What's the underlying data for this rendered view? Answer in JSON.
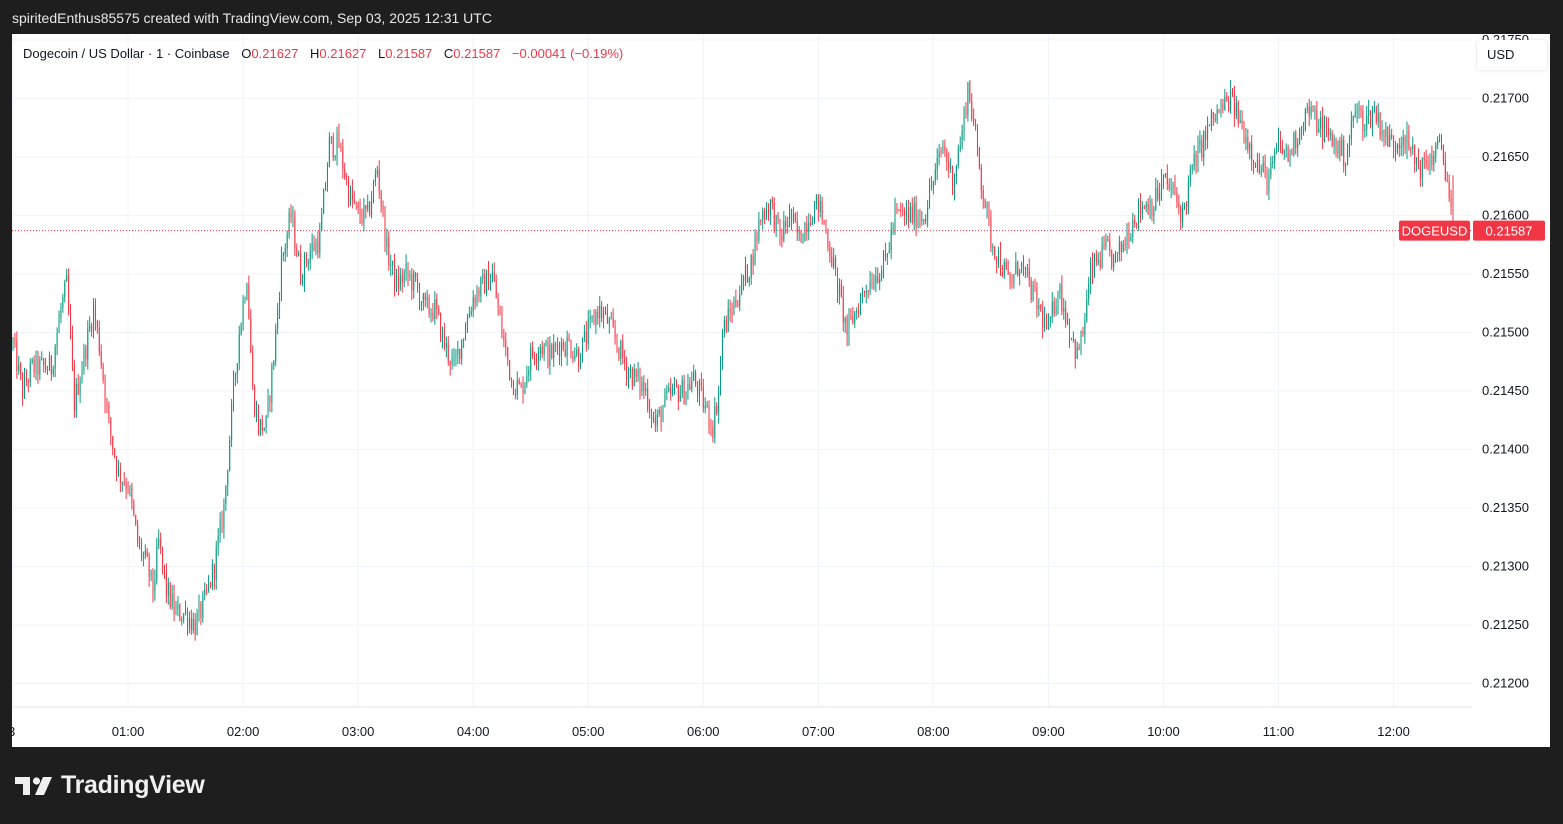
{
  "header": {
    "credit": "spiritedEnthus85575 created with TradingView.com, Sep 03, 2025 12:31 UTC"
  },
  "legend": {
    "symbol": "Dogecoin / US Dollar · 1 · Coinbase",
    "open_label": "O",
    "open": "0.21627",
    "high_label": "H",
    "high": "0.21627",
    "low_label": "L",
    "low": "0.21587",
    "close_label": "C",
    "close": "0.21587",
    "change": "−0.00041 (−0.19%)"
  },
  "currency_button": "USD",
  "price_tag": {
    "symbol": "DOGEUSD",
    "price": "0.21587"
  },
  "logo": {
    "text": "TradingView",
    "icon": "tradingview-logo-icon"
  },
  "colors": {
    "up": "#089981",
    "down": "#f23645",
    "grid": "#f0f3fa",
    "background": "#ffffff"
  },
  "chart_data": {
    "type": "candlestick",
    "title": "Dogecoin / US Dollar · 1 · Coinbase",
    "interval_minutes": 1,
    "x_ticks": [
      "3",
      "01:00",
      "02:00",
      "03:00",
      "04:00",
      "05:00",
      "06:00",
      "07:00",
      "08:00",
      "09:00",
      "10:00",
      "11:00",
      "12:00"
    ],
    "y_ticks": [
      "0.21200",
      "0.21250",
      "0.21300",
      "0.21350",
      "0.21400",
      "0.21450",
      "0.21500",
      "0.21550",
      "0.21600",
      "0.21650",
      "0.21700",
      "0.21750"
    ],
    "ylim": [
      0.2118,
      0.21755
    ],
    "x_range": [
      "00:00",
      "12:31"
    ],
    "last_price": 0.21587,
    "grid": true,
    "close_path": [
      [
        "00:00",
        0.2149
      ],
      [
        "00:05",
        0.2145
      ],
      [
        "00:10",
        0.2147
      ],
      [
        "00:15",
        0.2147
      ],
      [
        "00:20",
        0.2147
      ],
      [
        "00:25",
        0.2152
      ],
      [
        "00:28",
        0.2154
      ],
      [
        "00:32",
        0.2144
      ],
      [
        "00:37",
        0.2148
      ],
      [
        "00:42",
        0.2152
      ],
      [
        "00:45",
        0.2149
      ],
      [
        "00:50",
        0.2142
      ],
      [
        "00:55",
        0.2138
      ],
      [
        "01:00",
        0.2137
      ],
      [
        "01:05",
        0.2132
      ],
      [
        "01:10",
        0.213
      ],
      [
        "01:13",
        0.2128
      ],
      [
        "01:16",
        0.2132
      ],
      [
        "01:20",
        0.2128
      ],
      [
        "01:25",
        0.2126
      ],
      [
        "01:30",
        0.2126
      ],
      [
        "01:35",
        0.2125
      ],
      [
        "01:40",
        0.2127
      ],
      [
        "01:45",
        0.213
      ],
      [
        "01:50",
        0.2135
      ],
      [
        "01:55",
        0.2145
      ],
      [
        "01:58",
        0.215
      ],
      [
        "02:02",
        0.2155
      ],
      [
        "02:05",
        0.2145
      ],
      [
        "02:08",
        0.2142
      ],
      [
        "02:12",
        0.2142
      ],
      [
        "02:16",
        0.2148
      ],
      [
        "02:20",
        0.2156
      ],
      [
        "02:25",
        0.216
      ],
      [
        "02:30",
        0.2155
      ],
      [
        "02:35",
        0.2157
      ],
      [
        "02:40",
        0.2158
      ],
      [
        "02:45",
        0.2166
      ],
      [
        "02:50",
        0.2166
      ],
      [
        "02:55",
        0.2162
      ],
      [
        "03:00",
        0.216
      ],
      [
        "03:05",
        0.216
      ],
      [
        "03:10",
        0.2164
      ],
      [
        "03:15",
        0.2157
      ],
      [
        "03:20",
        0.2154
      ],
      [
        "03:25",
        0.2155
      ],
      [
        "03:30",
        0.2154
      ],
      [
        "03:35",
        0.2152
      ],
      [
        "03:40",
        0.2152
      ],
      [
        "03:45",
        0.2149
      ],
      [
        "03:50",
        0.2147
      ],
      [
        "03:55",
        0.215
      ],
      [
        "04:00",
        0.2153
      ],
      [
        "04:05",
        0.2154
      ],
      [
        "04:10",
        0.2155
      ],
      [
        "04:15",
        0.215
      ],
      [
        "04:20",
        0.2146
      ],
      [
        "04:25",
        0.2145
      ],
      [
        "04:30",
        0.2148
      ],
      [
        "04:35",
        0.2149
      ],
      [
        "04:40",
        0.2148
      ],
      [
        "04:45",
        0.2149
      ],
      [
        "04:50",
        0.2149
      ],
      [
        "04:55",
        0.2148
      ],
      [
        "05:00",
        0.215
      ],
      [
        "05:05",
        0.2152
      ],
      [
        "05:10",
        0.2151
      ],
      [
        "05:15",
        0.2149
      ],
      [
        "05:20",
        0.2147
      ],
      [
        "05:25",
        0.2146
      ],
      [
        "05:30",
        0.2145
      ],
      [
        "05:35",
        0.2142
      ],
      [
        "05:40",
        0.2144
      ],
      [
        "05:45",
        0.2145
      ],
      [
        "05:50",
        0.2145
      ],
      [
        "05:55",
        0.2146
      ],
      [
        "06:00",
        0.2144
      ],
      [
        "06:05",
        0.2142
      ],
      [
        "06:08",
        0.2145
      ],
      [
        "06:10",
        0.215
      ],
      [
        "06:15",
        0.2152
      ],
      [
        "06:20",
        0.2154
      ],
      [
        "06:25",
        0.2156
      ],
      [
        "06:30",
        0.216
      ],
      [
        "06:35",
        0.2161
      ],
      [
        "06:40",
        0.2158
      ],
      [
        "06:45",
        0.216
      ],
      [
        "06:50",
        0.2158
      ],
      [
        "06:55",
        0.216
      ],
      [
        "07:00",
        0.2161
      ],
      [
        "07:05",
        0.2158
      ],
      [
        "07:10",
        0.2154
      ],
      [
        "07:15",
        0.215
      ],
      [
        "07:20",
        0.2152
      ],
      [
        "07:25",
        0.2154
      ],
      [
        "07:30",
        0.2155
      ],
      [
        "07:35",
        0.2156
      ],
      [
        "07:40",
        0.216
      ],
      [
        "07:45",
        0.216
      ],
      [
        "07:50",
        0.216
      ],
      [
        "07:55",
        0.216
      ],
      [
        "08:00",
        0.2163
      ],
      [
        "08:05",
        0.2166
      ],
      [
        "08:10",
        0.2163
      ],
      [
        "08:15",
        0.2167
      ],
      [
        "08:18",
        0.2171
      ],
      [
        "08:20",
        0.2169
      ],
      [
        "08:25",
        0.2163
      ],
      [
        "08:30",
        0.2158
      ],
      [
        "08:35",
        0.2156
      ],
      [
        "08:40",
        0.2154
      ],
      [
        "08:45",
        0.2156
      ],
      [
        "08:50",
        0.2154
      ],
      [
        "08:55",
        0.2152
      ],
      [
        "09:00",
        0.215
      ],
      [
        "09:05",
        0.2154
      ],
      [
        "09:10",
        0.2151
      ],
      [
        "09:15",
        0.2148
      ],
      [
        "09:18",
        0.215
      ],
      [
        "09:22",
        0.2155
      ],
      [
        "09:25",
        0.2156
      ],
      [
        "09:30",
        0.2157
      ],
      [
        "09:35",
        0.2156
      ],
      [
        "09:40",
        0.2158
      ],
      [
        "09:45",
        0.216
      ],
      [
        "09:50",
        0.2161
      ],
      [
        "09:55",
        0.2161
      ],
      [
        "10:00",
        0.2163
      ],
      [
        "10:05",
        0.2162
      ],
      [
        "10:10",
        0.216
      ],
      [
        "10:15",
        0.2164
      ],
      [
        "10:20",
        0.2166
      ],
      [
        "10:25",
        0.2168
      ],
      [
        "10:30",
        0.2169
      ],
      [
        "10:35",
        0.217
      ],
      [
        "10:40",
        0.2168
      ],
      [
        "10:45",
        0.2166
      ],
      [
        "10:50",
        0.2164
      ],
      [
        "10:55",
        0.2163
      ],
      [
        "11:00",
        0.2166
      ],
      [
        "11:05",
        0.2165
      ],
      [
        "11:10",
        0.2167
      ],
      [
        "11:15",
        0.2169
      ],
      [
        "11:20",
        0.2168
      ],
      [
        "11:25",
        0.2167
      ],
      [
        "11:30",
        0.2166
      ],
      [
        "11:35",
        0.2165
      ],
      [
        "11:40",
        0.2169
      ],
      [
        "11:45",
        0.2168
      ],
      [
        "11:50",
        0.2169
      ],
      [
        "11:55",
        0.2167
      ],
      [
        "12:00",
        0.2166
      ],
      [
        "12:05",
        0.2167
      ],
      [
        "12:10",
        0.2165
      ],
      [
        "12:15",
        0.2164
      ],
      [
        "12:20",
        0.2165
      ],
      [
        "12:25",
        0.2166
      ],
      [
        "12:28",
        0.2163
      ],
      [
        "12:31",
        0.21587
      ]
    ]
  }
}
